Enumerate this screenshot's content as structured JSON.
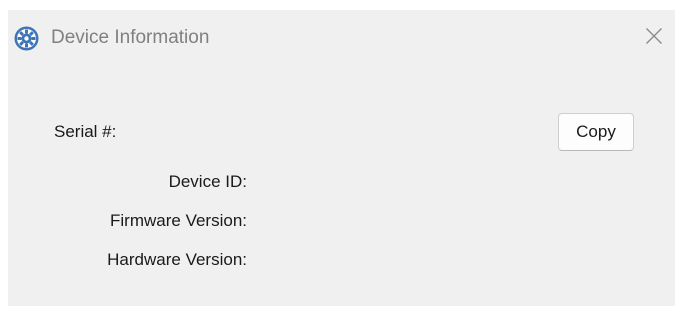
{
  "window": {
    "title": "Device Information",
    "app_icon": "settings-gear-icon",
    "close_icon": "close-icon"
  },
  "fields": {
    "serial_label": "Serial #:",
    "device_id_label": "Device ID:",
    "firmware_label": "Firmware Version:",
    "hardware_label": "Hardware Version:"
  },
  "actions": {
    "copy_label": "Copy"
  },
  "colors": {
    "window_bg": "#f0f0f0",
    "icon_blue": "#3f74b5",
    "title_gray": "#808080"
  }
}
